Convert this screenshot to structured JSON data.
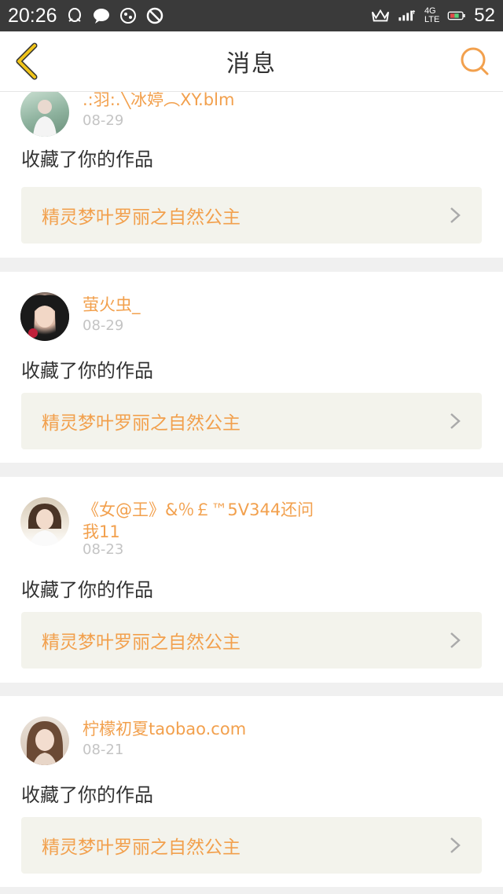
{
  "status_bar": {
    "time": "20:26",
    "network": "4G",
    "network_sub": "LTE",
    "battery": "52"
  },
  "header": {
    "title": "消息"
  },
  "colors": {
    "accent": "#f2a04d",
    "back_arrow": "#f0c419",
    "card_link_bg": "#f3f3ec",
    "status_bar_bg": "#3a3a3a"
  },
  "messages": [
    {
      "user": ".:羽:.╲冰婷︵XY.blm",
      "date": "08-29",
      "action": "收藏了你的作品",
      "work": "精灵梦叶罗丽之自然公主",
      "avatar_icon": "avatar-photo-icon"
    },
    {
      "user": "萤火虫_",
      "date": "08-29",
      "action": "收藏了你的作品",
      "work": "精灵梦叶罗丽之自然公主",
      "avatar_icon": "avatar-photo-icon"
    },
    {
      "user": "《女@王》&％￡™5V344还问我11",
      "date": "08-23",
      "action": "收藏了你的作品",
      "work": "精灵梦叶罗丽之自然公主",
      "avatar_icon": "avatar-photo-icon"
    },
    {
      "user": "柠檬初夏taobao.com",
      "date": "08-21",
      "action": "收藏了你的作品",
      "work": "精灵梦叶罗丽之自然公主",
      "avatar_icon": "avatar-photo-icon"
    }
  ]
}
